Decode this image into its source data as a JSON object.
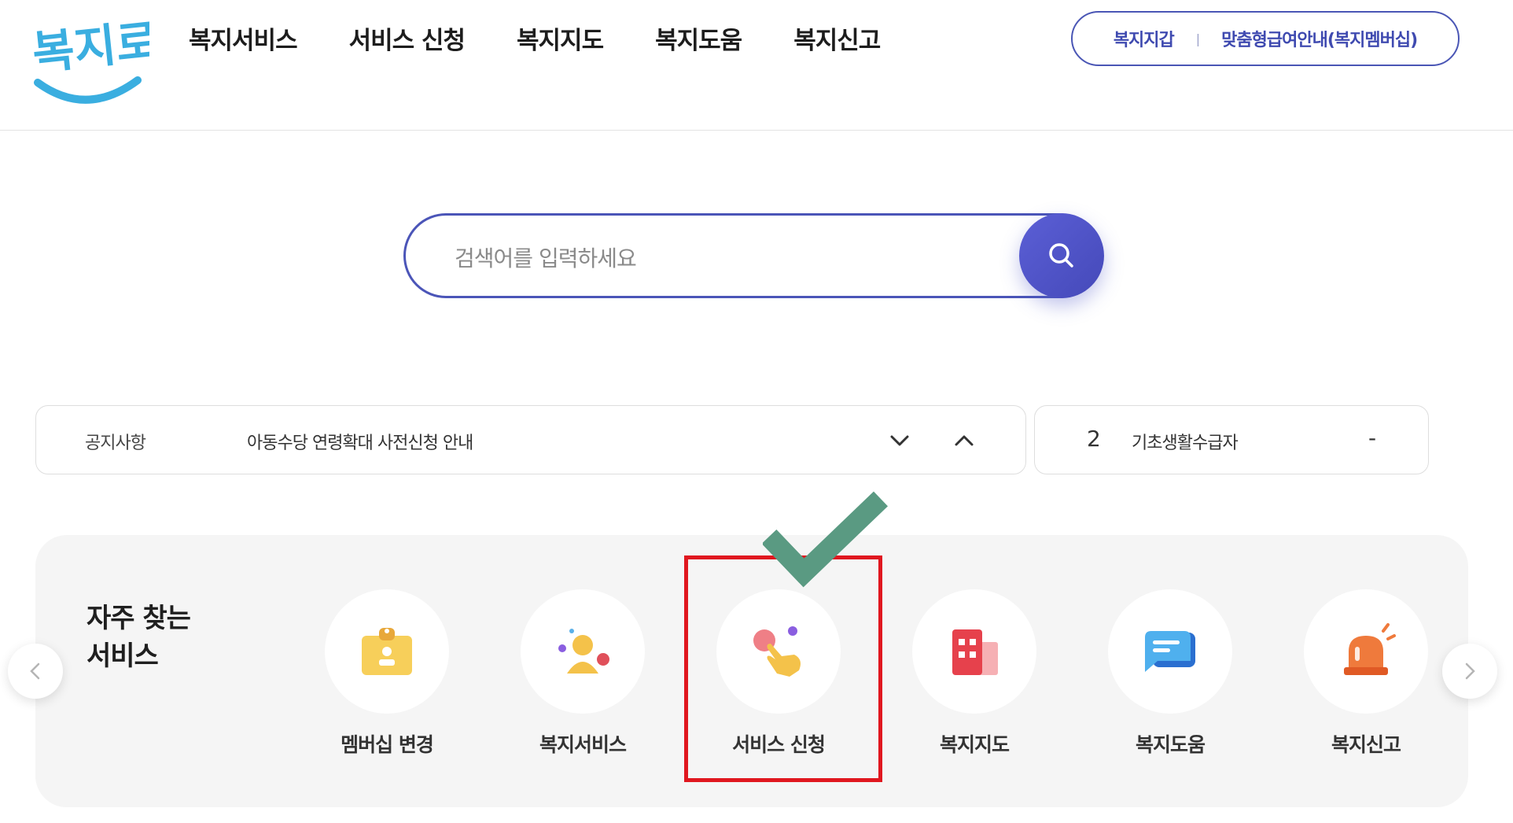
{
  "header": {
    "logo_text": "복지로",
    "nav": [
      "복지서비스",
      "서비스 신청",
      "복지지도",
      "복지도움",
      "복지신고"
    ],
    "pill": {
      "wallet": "복지지갑",
      "separator": "|",
      "membership": "맞춤형급여안내(복지멤버십)"
    }
  },
  "search": {
    "placeholder": "검색어를 입력하세요",
    "value": "",
    "button_icon": "search-icon",
    "accent_color": "#4b55b8"
  },
  "notice": {
    "label": "공지사항",
    "text": "아동수당 연령확대 사전신청 안내"
  },
  "ranking": {
    "rank": "2",
    "keyword": "기초생활수급자",
    "change": "-"
  },
  "frequent_services": {
    "title_line1": "자주 찾는",
    "title_line2": "서비스",
    "items": [
      {
        "label": "멤버십 변경",
        "icon": "membership-card-icon"
      },
      {
        "label": "복지서비스",
        "icon": "person-icon"
      },
      {
        "label": "서비스 신청",
        "icon": "hand-pointer-icon"
      },
      {
        "label": "복지지도",
        "icon": "building-icon"
      },
      {
        "label": "복지도움",
        "icon": "chat-bubble-icon"
      },
      {
        "label": "복지신고",
        "icon": "alarm-siren-icon"
      }
    ]
  },
  "annotation": {
    "highlight_color": "#e0171f",
    "check_color": "#5a9a82"
  }
}
